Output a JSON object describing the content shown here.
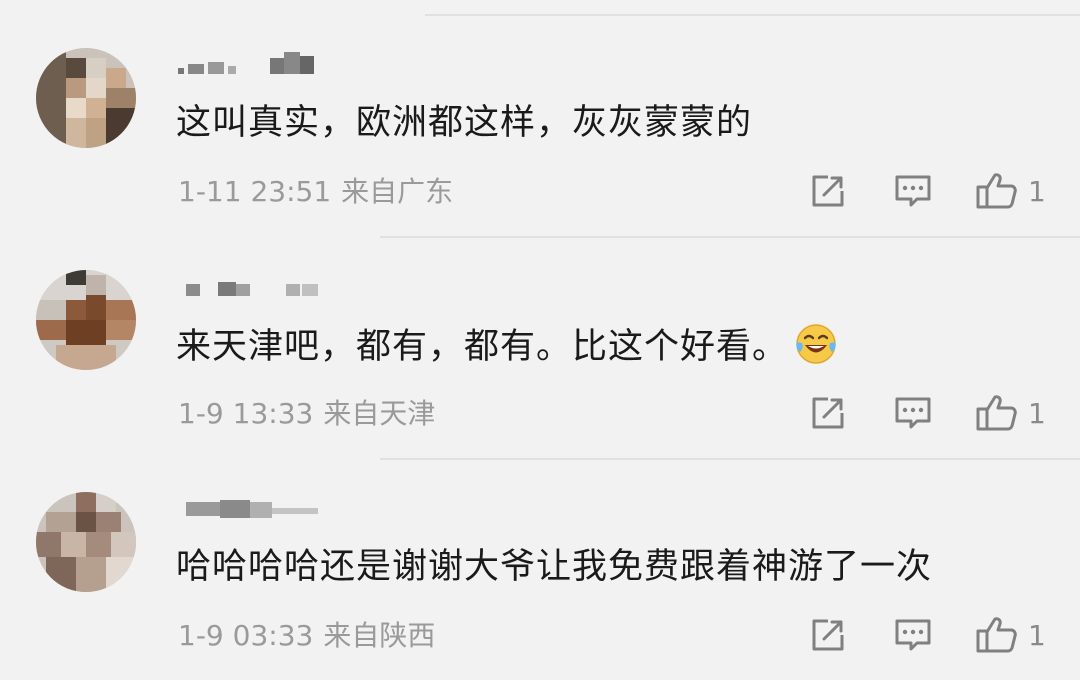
{
  "comments": [
    {
      "text": "这叫真实，欧洲都这样，灰灰蒙蒙的",
      "time": "1-11 23:51",
      "location": "来自广东",
      "likes": "1",
      "has_emoji": false
    },
    {
      "text": "来天津吧，都有，都有。比这个好看。",
      "time": "1-9 13:33",
      "location": "来自天津",
      "likes": "1",
      "has_emoji": true,
      "emoji": "laughing-tears"
    },
    {
      "text": "哈哈哈哈还是谢谢大爷让我免费跟着神游了一次",
      "time": "1-9 03:33",
      "location": "来自陕西",
      "likes": "1",
      "has_emoji": false
    }
  ],
  "icons": {
    "share": "share-icon",
    "reply": "comment-icon",
    "like": "thumbs-up-icon"
  },
  "colors": {
    "background": "#f2f2f2",
    "text": "#1a1a1a",
    "meta": "#9a9a9a",
    "icon": "#808080"
  }
}
